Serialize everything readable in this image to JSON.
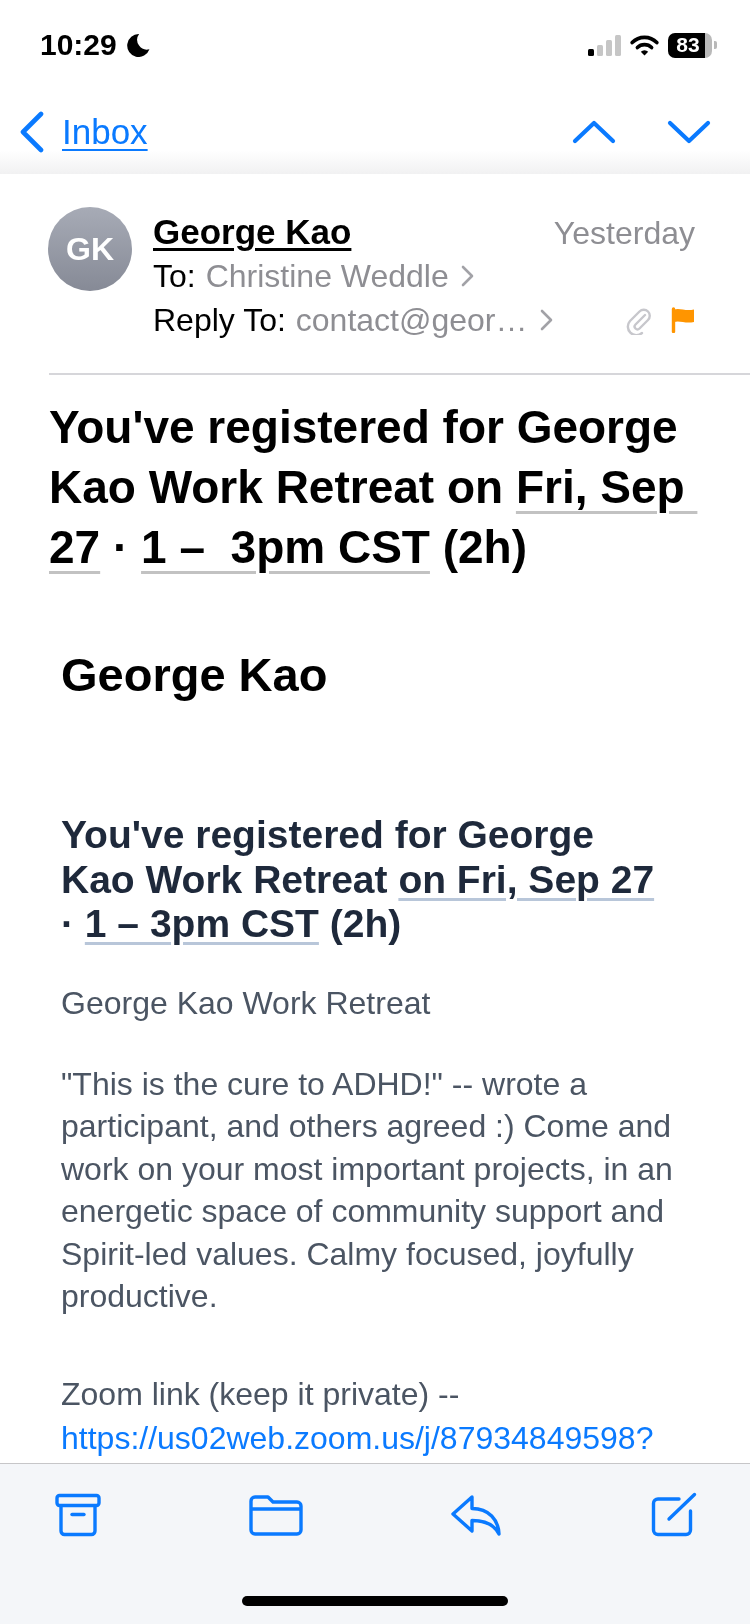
{
  "status_bar": {
    "time": "10:29",
    "battery": "83"
  },
  "nav": {
    "back_label": "Inbox"
  },
  "message": {
    "avatar": "GK",
    "sender": "George Kao",
    "date": "Yesterday",
    "to_label": "To:",
    "to": "Christine Weddle",
    "reply_to_label": "Reply To:",
    "reply_to": "contact@geor…",
    "has_attachment": true,
    "flagged": true
  },
  "subject": [
    {
      "kind": "text",
      "text": "You've registered for George Kao Work Retreat on "
    },
    {
      "kind": "link",
      "text": "Fri, Sep "
    },
    {
      "kind": "link",
      "text": "27"
    },
    {
      "kind": "text",
      "text": " · "
    },
    {
      "kind": "link",
      "text": "1 –  3pm CST"
    },
    {
      "kind": "text",
      "text": " (2h)"
    }
  ],
  "body": {
    "sender_heading": "George Kao",
    "heading": [
      {
        "kind": "text",
        "text": "You've registered for George Kao Work Retreat "
      },
      {
        "kind": "link",
        "text": "on Fri, Sep 27"
      },
      {
        "kind": "text",
        "text": " · "
      },
      {
        "kind": "link",
        "text": "1 – 3pm CST"
      },
      {
        "kind": "text",
        "text": " (2h)"
      }
    ],
    "event_name": "George Kao Work Retreat",
    "description": "\"This is the cure to ADHD!\" -- wrote a participant, and others agreed :) Come and work on your most important projects, in an energetic space of community support and Spirit-led values. Calmy focused, joyfully productive.",
    "zoom_label": "Zoom link (keep it private) --",
    "zoom_link": "https://us02web.zoom.us/j/87934849598?"
  }
}
